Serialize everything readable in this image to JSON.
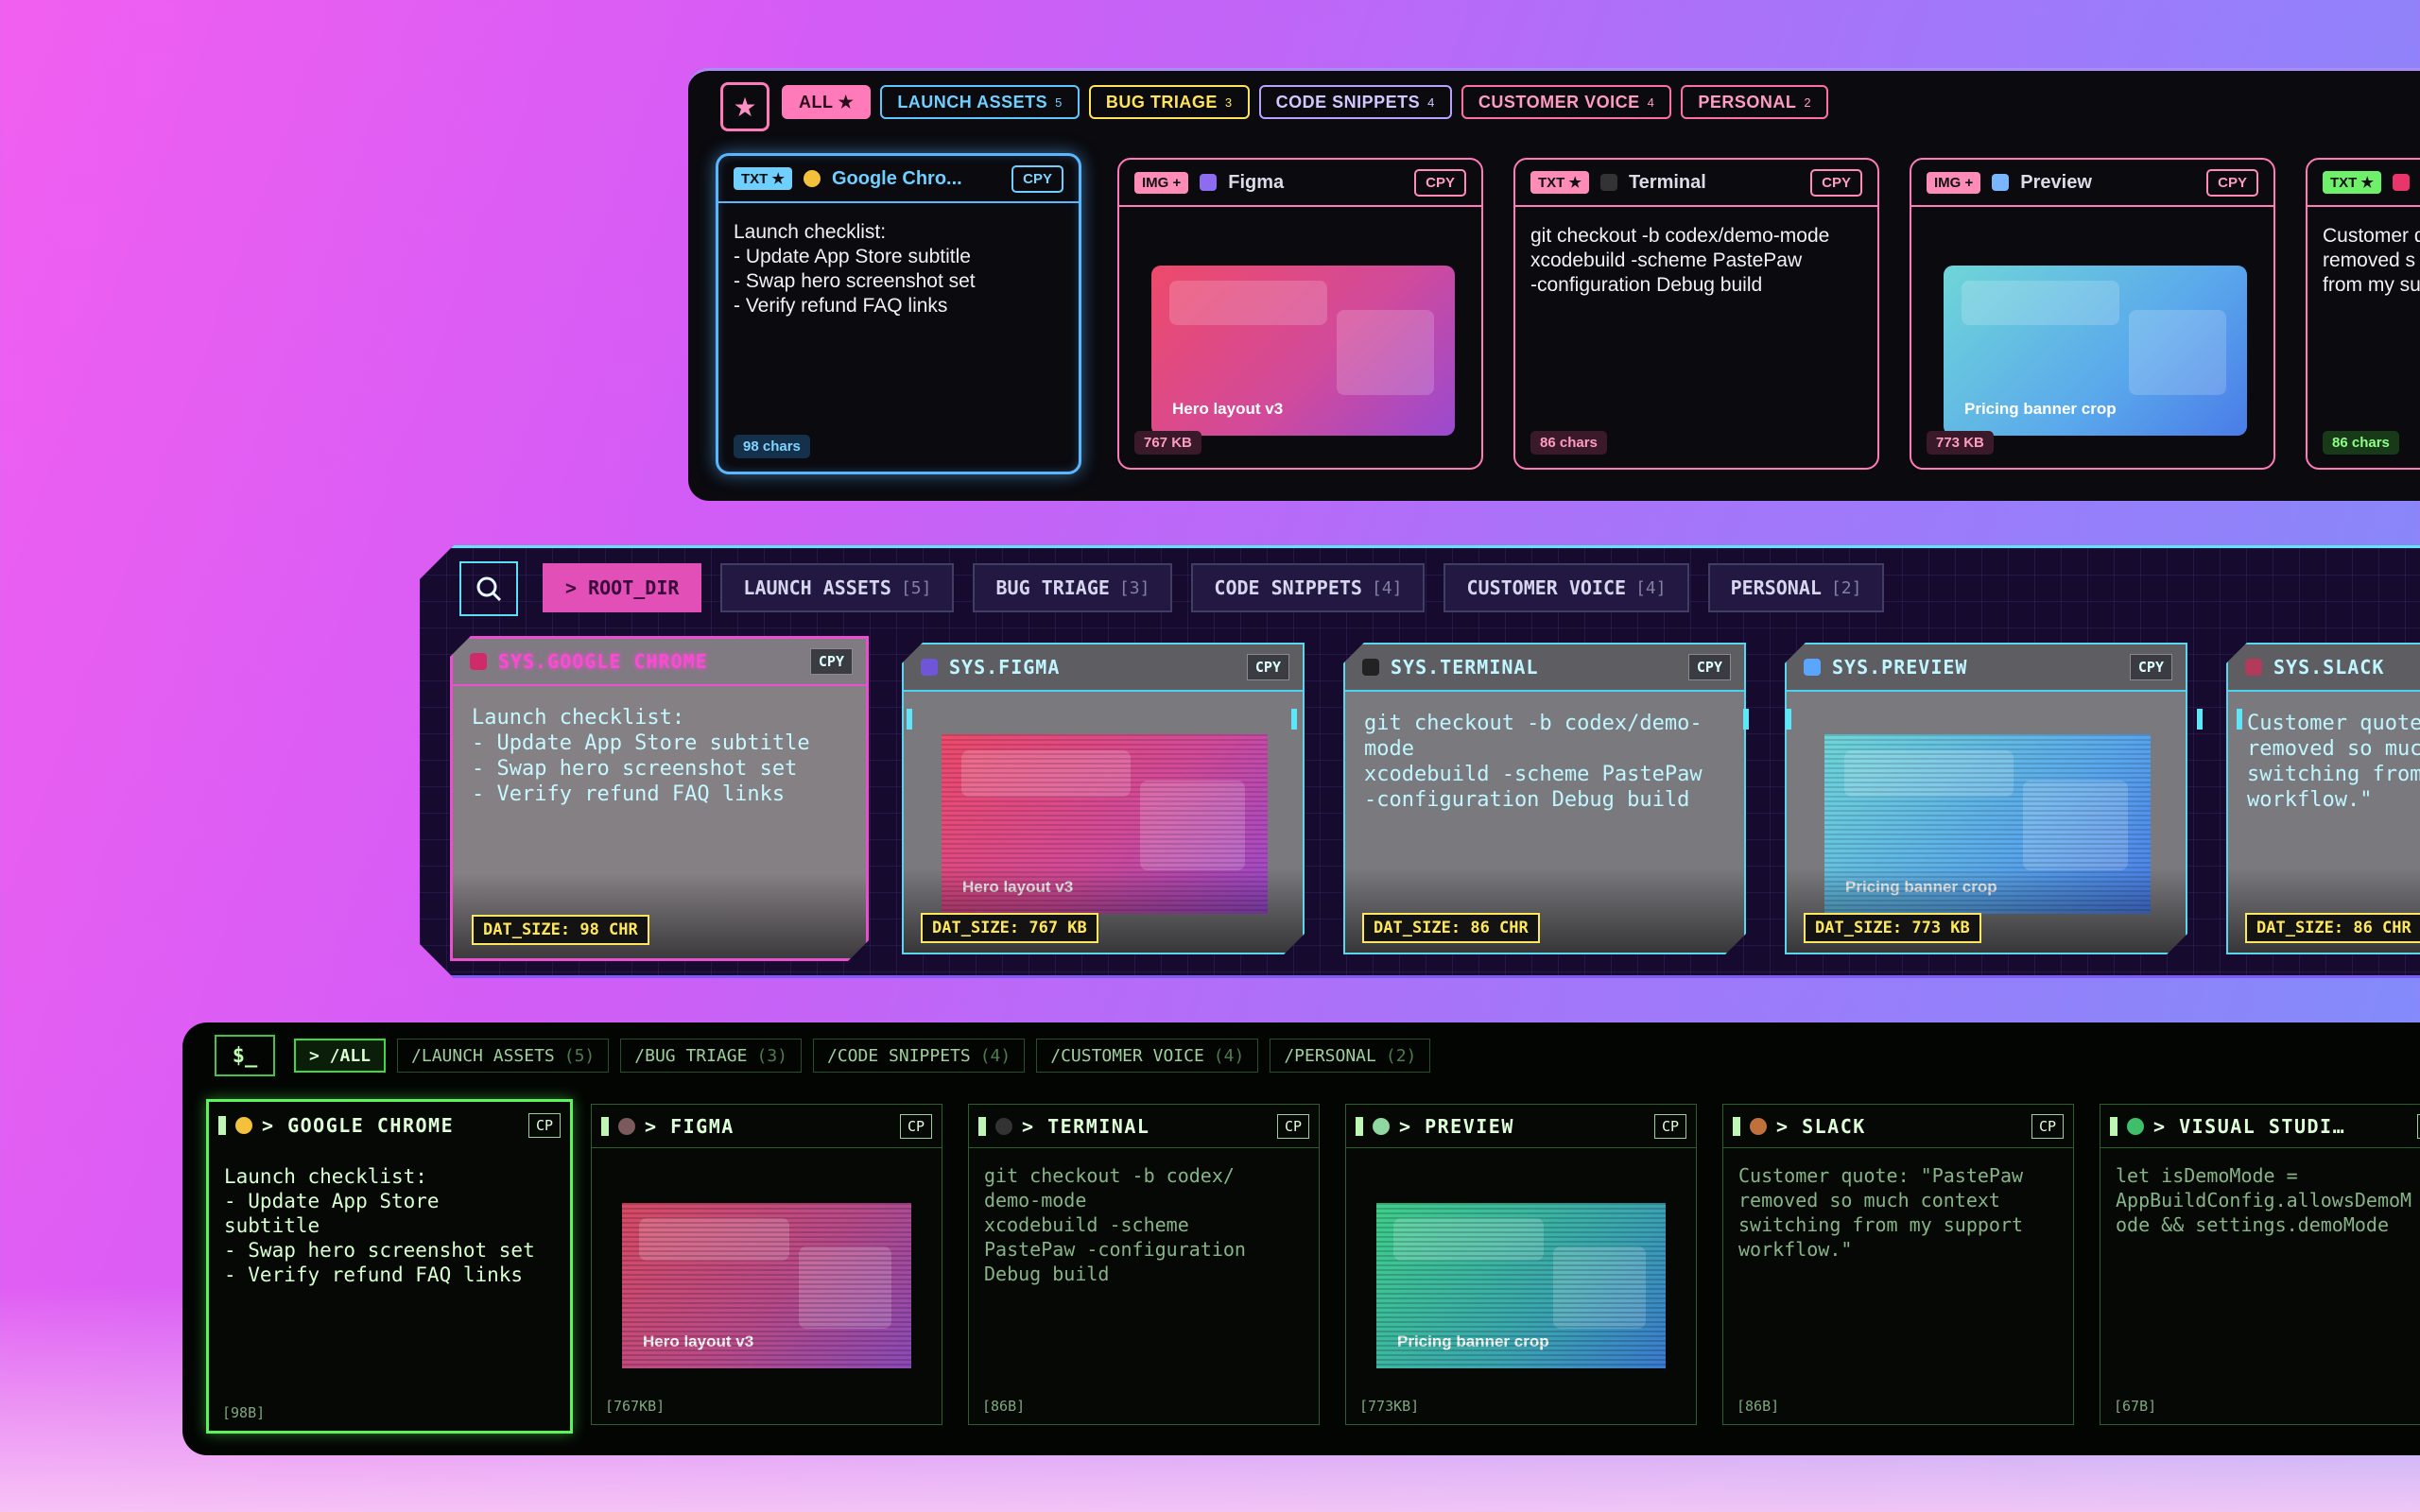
{
  "colors": {
    "pink": "#ff7ab8",
    "cyan": "#5edff7",
    "yellow": "#ffe75c",
    "green": "#5bf55b"
  },
  "neon": {
    "star_icon": "star-icon",
    "tabs": [
      {
        "label": "ALL ★",
        "count": "",
        "color": "#ff7ab8",
        "fill": "#ff7ab8",
        "text": "#2b0a1c"
      },
      {
        "label": "LAUNCH ASSETS",
        "count": "5",
        "color": "#5fc6ff",
        "fill": "",
        "text": "#6fd0ff"
      },
      {
        "label": "BUG TRIAGE",
        "count": "3",
        "color": "#ffe45a",
        "fill": "",
        "text": "#ffe45a"
      },
      {
        "label": "CODE SNIPPETS",
        "count": "4",
        "color": "#b9a3ff",
        "fill": "",
        "text": "#d4c6ff"
      },
      {
        "label": "CUSTOMER VOICE",
        "count": "4",
        "color": "#ff6fa0",
        "fill": "",
        "text": "#ff9cc0"
      },
      {
        "label": "PERSONAL",
        "count": "2",
        "color": "#ff6fa0",
        "fill": "",
        "text": "#ff9cc0"
      }
    ],
    "cards": [
      {
        "type": "TXT ★",
        "type_color": "#6fcfff",
        "app": "Google Chro...",
        "app_color": "#6fcfff",
        "border": "#5ab6ff",
        "icon": "chrome-icon",
        "icon_color": "#f4c13a",
        "cpy": "CPY",
        "text": "Launch checklist:\n- Update App Store subtitle\n- Swap hero screenshot set\n- Verify refund FAQ links",
        "size": "98 chars",
        "foot_bg": "#15304a",
        "foot_color": "#7fd4ff"
      },
      {
        "type": "IMG +",
        "type_color": "#ff8cb8",
        "app": "Figma",
        "app_color": "#dcdce8",
        "border": "#ff7ab8",
        "icon": "figma-icon",
        "icon_color": "#8d6cf0",
        "cpy": "CPY",
        "image_label": "",
        "size": "767 KB",
        "foot_bg": "#3a1a2a",
        "foot_color": "#ff9cc0"
      },
      {
        "type": "TXT ★",
        "type_color": "#ff8cb8",
        "app": "Terminal",
        "app_color": "#dcdce8",
        "border": "#ff7ab8",
        "icon": "terminal-icon",
        "icon_color": "#333",
        "cpy": "CPY",
        "text": "git checkout -b codex/demo-mode\nxcodebuild -scheme PastePaw\n-configuration Debug build",
        "size": "86 chars",
        "foot_bg": "#3a1a2a",
        "foot_color": "#ff9cc0"
      },
      {
        "type": "IMG +",
        "type_color": "#ff8cb8",
        "app": "Preview",
        "app_color": "#dcdce8",
        "border": "#ff7ab8",
        "icon": "preview-icon",
        "icon_color": "#7ab6ff",
        "cpy": "CPY",
        "image_label": "",
        "size": "773 KB",
        "foot_bg": "#3a1a2a",
        "foot_color": "#ff9cc0"
      },
      {
        "type": "TXT ★",
        "type_color": "#6ff06a",
        "app": "",
        "app_color": "#dcdce8",
        "border": "#ff7ab8",
        "icon": "slack-icon",
        "icon_color": "#e8356c",
        "cpy": "",
        "text": "Customer q\nremoved s\nfrom my su",
        "size": "86 chars",
        "foot_bg": "#183a18",
        "foot_color": "#8cff84"
      }
    ]
  },
  "images": {
    "hero": "Hero layout v3",
    "pricing": "Pricing banner crop"
  },
  "cyber": {
    "search_icon": "search-icon",
    "tabs": [
      {
        "label": "> ROOT_DIR",
        "count": ""
      },
      {
        "label": "LAUNCH ASSETS",
        "count": "[5]"
      },
      {
        "label": "BUG TRIAGE",
        "count": "[3]"
      },
      {
        "label": "CODE SNIPPETS",
        "count": "[4]"
      },
      {
        "label": "CUSTOMER VOICE",
        "count": "[4]"
      },
      {
        "label": "PERSONAL",
        "count": "[2]"
      }
    ],
    "cards": [
      {
        "app": "SYS.GOOGLE CHROME",
        "icon": "chrome-icon",
        "icon_color": "#d02a6a",
        "cpy": "CPY",
        "text": "Launch checklist:\n- Update App Store subtitle\n- Swap hero screenshot set\n- Verify refund FAQ links",
        "size": "DAT_SIZE: 98 CHR"
      },
      {
        "app": "SYS.FIGMA",
        "icon": "figma-icon",
        "icon_color": "#6f55d8",
        "cpy": "CPY",
        "size": "DAT_SIZE: 767 KB"
      },
      {
        "app": "SYS.TERMINAL",
        "icon": "terminal-icon",
        "icon_color": "#222",
        "cpy": "CPY",
        "text": "git checkout -b codex/demo-\nmode\nxcodebuild -scheme PastePaw\n-configuration Debug build",
        "size": "DAT_SIZE: 86 CHR"
      },
      {
        "app": "SYS.PREVIEW",
        "icon": "preview-icon",
        "icon_color": "#5aa6ff",
        "cpy": "CPY",
        "size": "DAT_SIZE: 773 KB"
      },
      {
        "app": "SYS.SLACK",
        "icon": "slack-icon",
        "icon_color": "#b23a5a",
        "cpy": "",
        "text": "Customer quote\nremoved so muc\nswitching from\nworkflow.\"",
        "size": "DAT_SIZE: 86 CHR"
      }
    ]
  },
  "term": {
    "prompt": "$_",
    "tabs": [
      {
        "label": "> /ALL",
        "count": ""
      },
      {
        "label": "/LAUNCH ASSETS",
        "count": "(5)"
      },
      {
        "label": "/BUG TRIAGE",
        "count": "(3)"
      },
      {
        "label": "/CODE SNIPPETS",
        "count": "(4)"
      },
      {
        "label": "/CUSTOMER VOICE",
        "count": "(4)"
      },
      {
        "label": "/PERSONAL",
        "count": "(2)"
      }
    ],
    "cards": [
      {
        "app": "> GOOGLE CHROME",
        "icon": "chrome-icon",
        "icon_color": "#f4c13a",
        "cpy": "CP",
        "text": "Launch checklist:\n- Update App Store\nsubtitle\n- Swap hero screenshot set\n- Verify refund FAQ links",
        "size": "[98B]"
      },
      {
        "app": "> FIGMA",
        "icon": "figma-icon",
        "icon_color": "#7a5a5a",
        "cpy": "CP",
        "size": "[767KB]"
      },
      {
        "app": "> TERMINAL",
        "icon": "terminal-icon",
        "icon_color": "#333",
        "cpy": "CP",
        "text": "git checkout -b codex/\ndemo-mode\nxcodebuild -scheme\nPastePaw -configuration\nDebug build",
        "size": "[86B]"
      },
      {
        "app": "> PREVIEW",
        "icon": "preview-icon",
        "icon_color": "#8fd6a0",
        "cpy": "CP",
        "size": "[773KB]"
      },
      {
        "app": "> SLACK",
        "icon": "slack-icon",
        "icon_color": "#c0703a",
        "cpy": "CP",
        "text": "Customer quote: \"PastePaw\nremoved so much context\nswitching from my support\nworkflow.\"",
        "size": "[86B]"
      },
      {
        "app": "> VISUAL STUDI…",
        "icon": "vscode-icon",
        "icon_color": "#3fbf6a",
        "cpy": "C",
        "text": "let isDemoMode =\nAppBuildConfig.allowsDemoM\node && settings.demoMode",
        "size": "[67B]"
      }
    ]
  }
}
